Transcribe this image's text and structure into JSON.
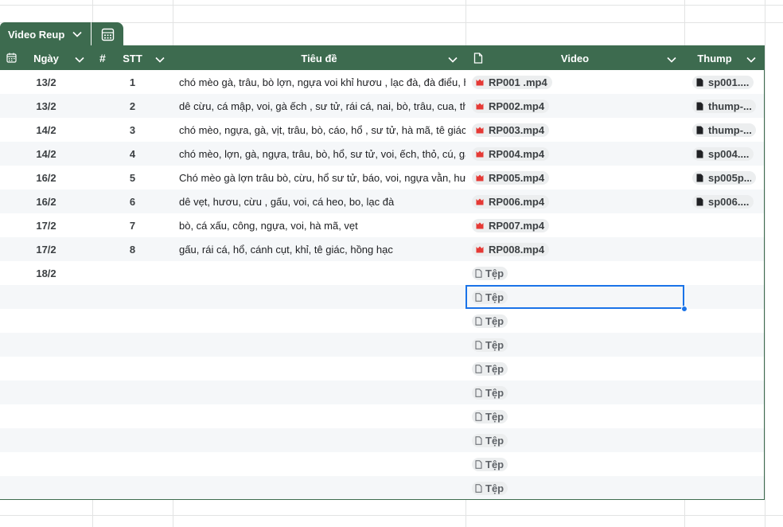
{
  "tab": {
    "label": "Video Reup",
    "chevron_icon": "chevron-down-icon",
    "calc_icon": "calculator-icon"
  },
  "columns": [
    {
      "key": "date",
      "label": "Ngày",
      "icon": "calendar-icon"
    },
    {
      "key": "stt",
      "label": "STT",
      "icon": "hash-icon"
    },
    {
      "key": "title",
      "label": "Tiêu đề",
      "icon": ""
    },
    {
      "key": "video",
      "label": "Video",
      "icon": "file-icon"
    },
    {
      "key": "thump",
      "label": "Thump",
      "icon": ""
    }
  ],
  "hash_symbol": "#",
  "rows": [
    {
      "date": "13/2",
      "stt": "1",
      "title": "chó mèo gà, trâu, bò lợn, ngựa voi khỉ hươu , lạc đà, đà điểu, h",
      "video": "RP001 .mp4",
      "thump": "sp001...."
    },
    {
      "date": "13/2",
      "stt": "2",
      "title": "dê cừu, cá mập, voi, gà ếch , sư tử, rái cá, nai, bò, trâu, cua, thỏ",
      "video": "RP002.mp4",
      "thump": "thump-..."
    },
    {
      "date": "14/2",
      "stt": "3",
      "title": "chó mèo, ngựa, gà, vịt, trâu, bò, cáo, hổ , sư tử, hà mã, tê giác,",
      "video": "RP003.mp4",
      "thump": "thump-..."
    },
    {
      "date": "14/2",
      "stt": "4",
      "title": "chó mèo, lợn, gà, ngựa, trâu, bò, hổ, sư tử, voi, ếch, thỏ, cú, gấu",
      "video": "RP004.mp4",
      "thump": "sp004...."
    },
    {
      "date": "16/2",
      "stt": "5",
      "title": "Chó mèo gà lợn trâu bò, cừu, hổ sư tử, báo, voi, ngựa vằn, hươ",
      "video": "RP005.mp4",
      "thump": "sp005p..."
    },
    {
      "date": "16/2",
      "stt": "6",
      "title": "dê vẹt, hươu, cừu , gấu, voi, cá heo, bo, lạc đà",
      "video": "RP006.mp4",
      "thump": "sp006...."
    },
    {
      "date": "17/2",
      "stt": "7",
      "title": "bò, cá xấu, công, ngựa, voi, hà mã, vẹt",
      "video": "RP007.mp4",
      "thump": ""
    },
    {
      "date": "17/2",
      "stt": "8",
      "title": "gấu, rái cá, hổ, cánh cụt, khỉ, tê giác, hồng hạc",
      "video": "RP008.mp4",
      "thump": ""
    },
    {
      "date": "18/2",
      "stt": "",
      "title": "",
      "video": "",
      "thump": ""
    },
    {
      "date": "",
      "stt": "",
      "title": "",
      "video": "",
      "thump": ""
    },
    {
      "date": "",
      "stt": "",
      "title": "",
      "video": "",
      "thump": ""
    },
    {
      "date": "",
      "stt": "",
      "title": "",
      "video": "",
      "thump": ""
    },
    {
      "date": "",
      "stt": "",
      "title": "",
      "video": "",
      "thump": ""
    },
    {
      "date": "",
      "stt": "",
      "title": "",
      "video": "",
      "thump": ""
    },
    {
      "date": "",
      "stt": "",
      "title": "",
      "video": "",
      "thump": ""
    },
    {
      "date": "",
      "stt": "",
      "title": "",
      "video": "",
      "thump": ""
    },
    {
      "date": "",
      "stt": "",
      "title": "",
      "video": "",
      "thump": ""
    },
    {
      "date": "",
      "stt": "",
      "title": "",
      "video": "",
      "thump": ""
    }
  ],
  "empty_file_label": "Tệp",
  "colors": {
    "header": "#3d6b4f",
    "selection": "#1a73e8",
    "video_icon": "#e53935",
    "alt_row": "#f5f7f9"
  }
}
